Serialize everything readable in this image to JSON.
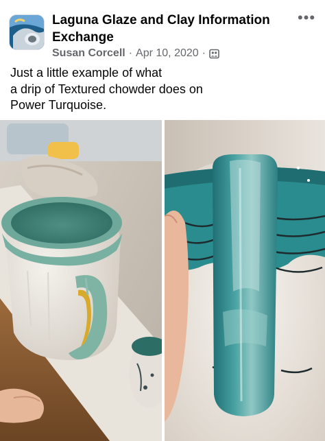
{
  "post": {
    "group_name": "Laguna Glaze and Clay Information Exchange",
    "author": "Susan Corcell",
    "separator": "·",
    "date": "Apr 10, 2020",
    "audience_icon": "group-audience-icon",
    "more_options": "•••",
    "text_lines": [
      "Just a little example of what",
      "a drip of Textured chowder does on",
      "Power Turquoise."
    ]
  },
  "photos": [
    {
      "subject": "handled-mug-side-view"
    },
    {
      "subject": "mug-handle-closeup"
    }
  ],
  "colors": {
    "text_primary": "#050505",
    "text_secondary": "#65676b",
    "glaze_turquoise": "#2e8a8a"
  }
}
